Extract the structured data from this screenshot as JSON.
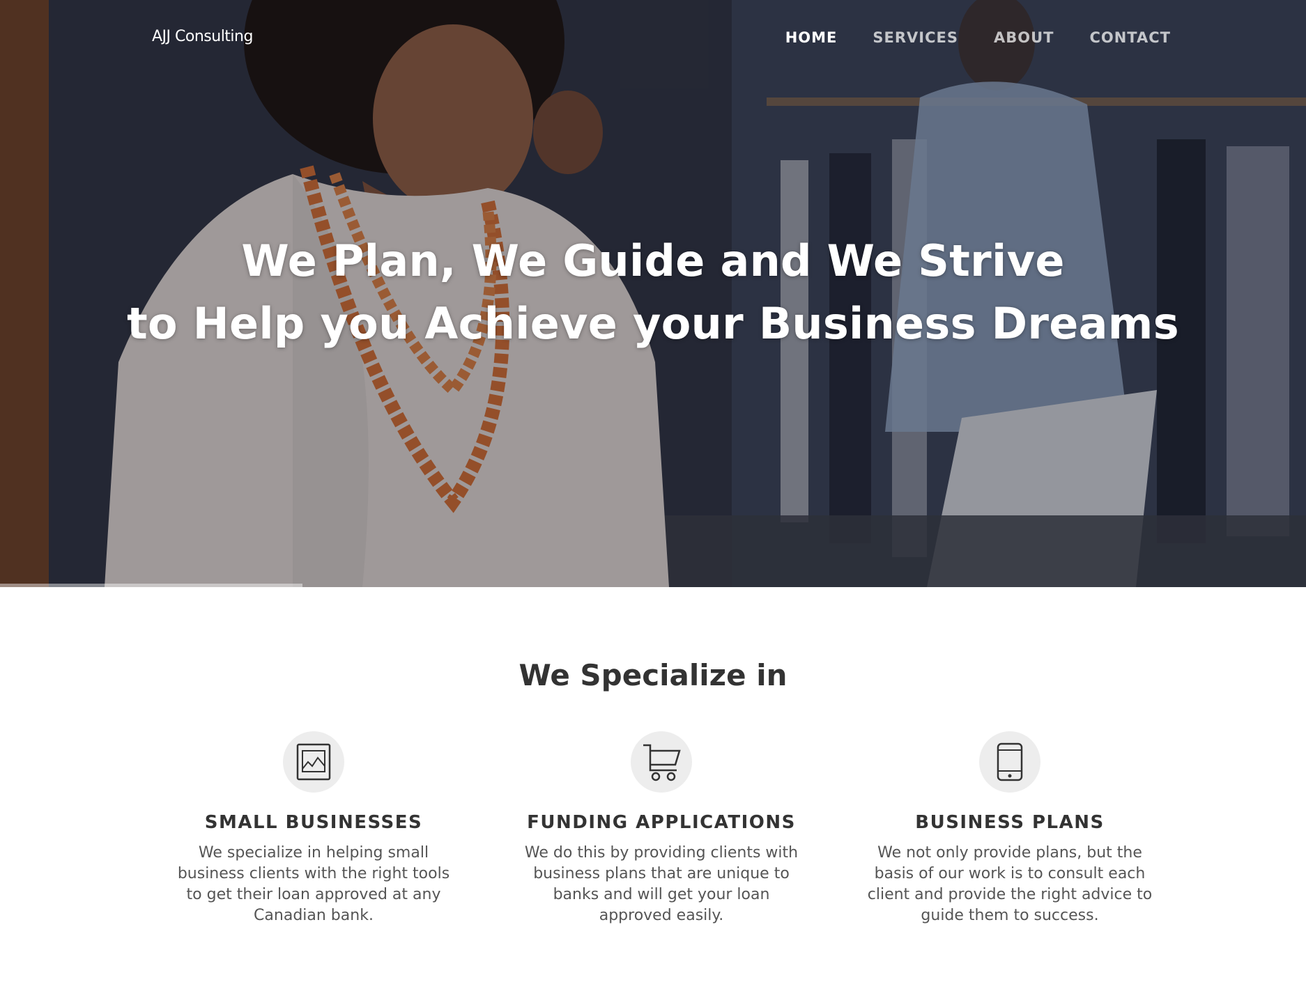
{
  "header": {
    "brand": "AJJ Consulting",
    "nav": [
      {
        "label": "HOME",
        "active": true
      },
      {
        "label": "SERVICES",
        "active": false
      },
      {
        "label": "ABOUT",
        "active": false
      },
      {
        "label": "CONTACT",
        "active": false
      }
    ]
  },
  "hero": {
    "title_line1": "We Plan, We Guide and We Strive",
    "title_line2": "to Help you Achieve your Business Dreams",
    "image": "woman-on-phone-in-clothing-store"
  },
  "services": {
    "heading": "We Specialize in",
    "items": [
      {
        "icon": "picture-frame-icon",
        "title": "SMALL BUSINESSES",
        "text": "We specialize in helping small business clients with the right tools to get their loan approved at any Canadian bank."
      },
      {
        "icon": "shopping-cart-icon",
        "title": "FUNDING APPLICATIONS",
        "text": "We do this by providing clients with business plans that are unique to banks and will get your loan approved easily."
      },
      {
        "icon": "mobile-phone-icon",
        "title": "BUSINESS PLANS",
        "text": "We not only provide plans, but the basis of our work is to consult each client and provide the right advice to guide them to success."
      }
    ]
  },
  "colors": {
    "text_dark": "#333333",
    "text_body": "#555555",
    "icon_bg": "#ededed",
    "nav_active": "#ffffff"
  }
}
